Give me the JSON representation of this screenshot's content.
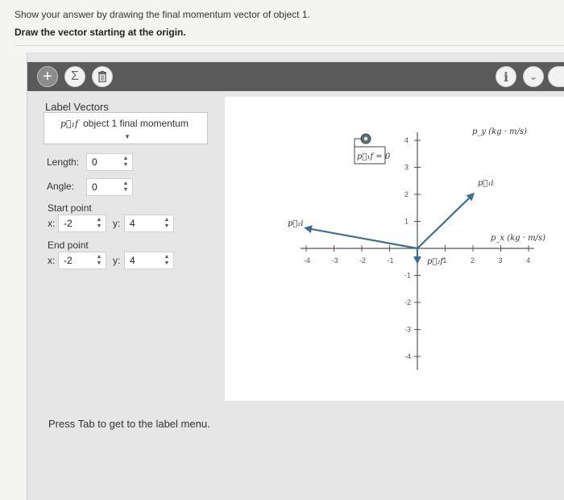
{
  "prompt": "Show your answer by drawing the final momentum vector of object 1.",
  "instruction": "Draw the vector starting at the origin.",
  "toolbar": {
    "plus_symbol": "+",
    "sigma_symbol": "Σ",
    "info_symbol": "i",
    "chevron_symbol": "⌄"
  },
  "panel": {
    "label_vectors": "Label Vectors",
    "selected_vector_symbol": "p⃗₁f",
    "selected_vector_text": "object 1 final momentum",
    "length_label": "Length:",
    "length_value": "0",
    "angle_label": "Angle:",
    "angle_value": "0",
    "start_label": "Start point",
    "start_x_label": "x:",
    "start_x_value": "-2",
    "start_y_label": "y:",
    "start_y_value": "4",
    "end_label": "End point",
    "end_x_label": "x:",
    "end_x_value": "-2",
    "end_y_label": "y:",
    "end_y_value": "4"
  },
  "graph": {
    "y_axis_label": "p_y (kg · m/s)",
    "x_axis_label": "p_x (kg · m/s)",
    "x_ticks": [
      "-4",
      "-3",
      "-2",
      "-1",
      "1",
      "2",
      "3",
      "4"
    ],
    "y_ticks": [
      "4",
      "3",
      "2",
      "1",
      "-1",
      "-2",
      "-3",
      "-4"
    ],
    "label_p1f_zero": "p⃗₁f = 0",
    "label_p2i": "p⃗₂i",
    "label_p1i": "p⃗₁i",
    "label_p2f": "p⃗₂f",
    "vectors": [
      {
        "name": "p1i",
        "start": [
          0,
          0
        ],
        "end": [
          2,
          2
        ]
      },
      {
        "name": "p2i",
        "start": [
          0,
          0
        ],
        "end": [
          -4,
          0.75
        ]
      },
      {
        "name": "p2f",
        "start": [
          0,
          0
        ],
        "end": [
          0,
          -0.5
        ]
      }
    ],
    "colors": {
      "vector": "#3c6e8f",
      "axis": "#555555",
      "marker": "#5b6f7c"
    }
  },
  "footer_hint": "Press Tab to get to the label menu."
}
